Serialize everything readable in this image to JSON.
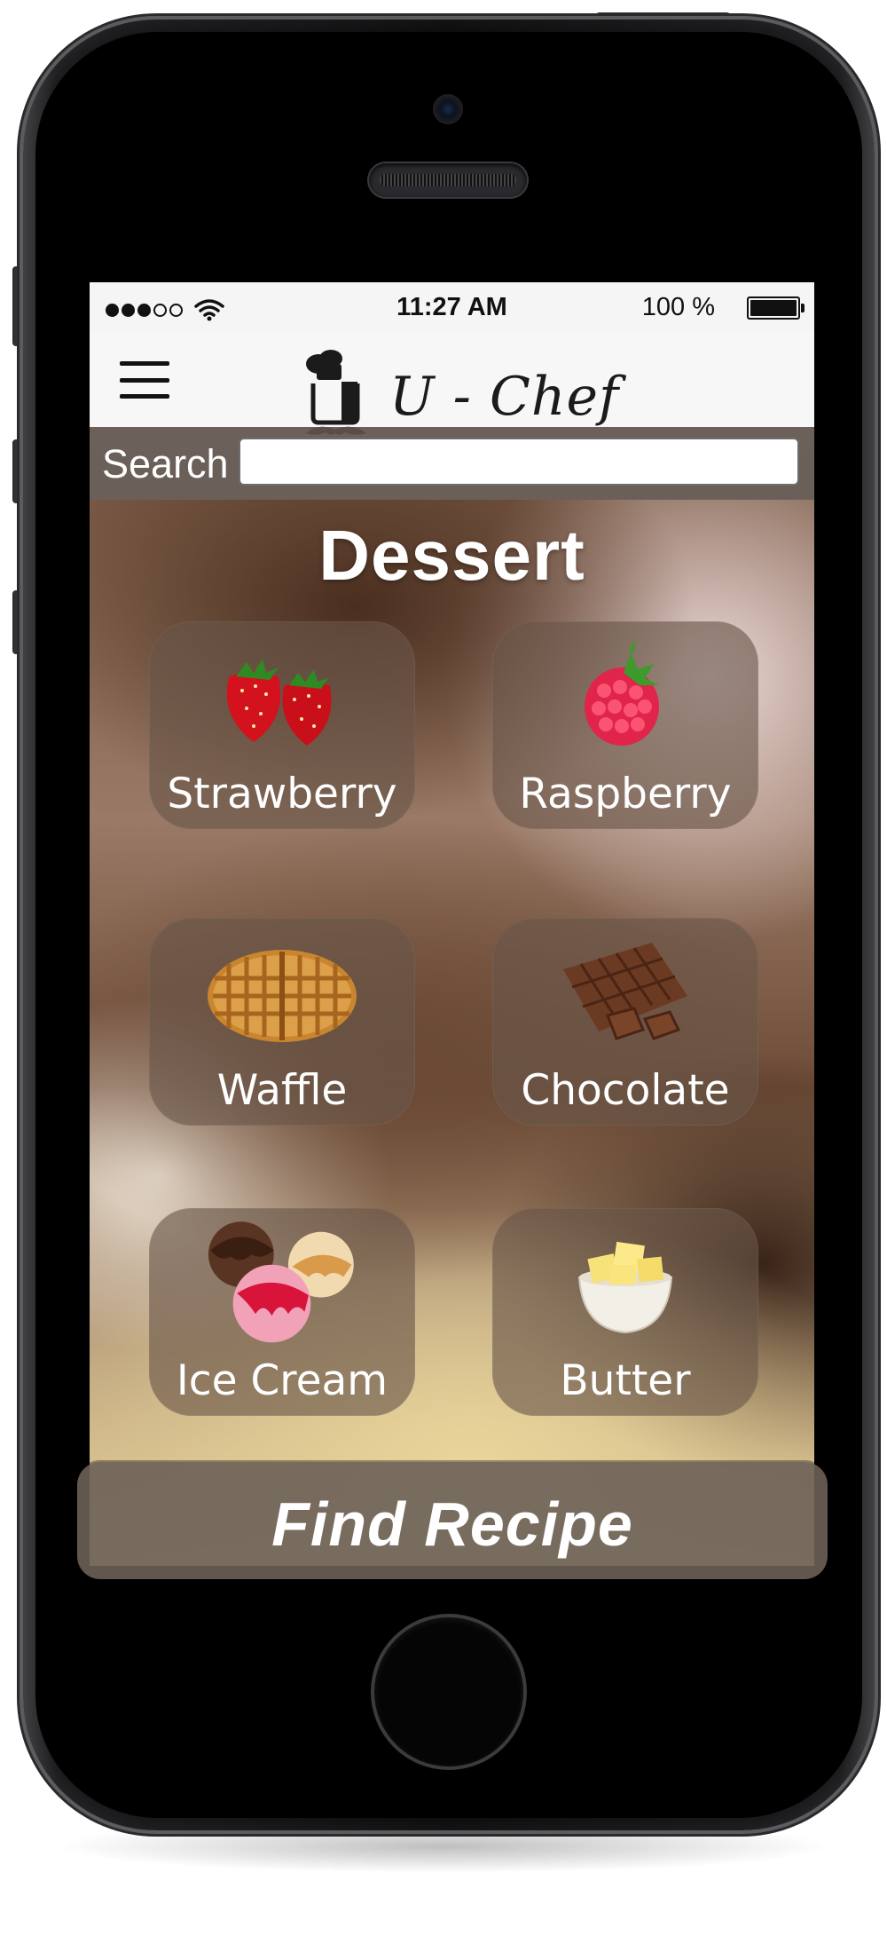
{
  "status_bar": {
    "time": "11:27 AM",
    "battery": "100 %"
  },
  "nav": {
    "app_name": "U - Chef",
    "menu_icon": "hamburger-icon",
    "logo_icon": "chef-mustache-logo"
  },
  "search": {
    "label": "Search",
    "value": "",
    "placeholder": ""
  },
  "page": {
    "title": "Dessert"
  },
  "categories": [
    {
      "label": "Strawberry",
      "icon": "strawberry-icon"
    },
    {
      "label": "Raspberry",
      "icon": "raspberry-icon"
    },
    {
      "label": "Waffle",
      "icon": "waffle-icon"
    },
    {
      "label": "Chocolate",
      "icon": "chocolate-icon"
    },
    {
      "label": "Ice Cream",
      "icon": "ice-cream-icon"
    },
    {
      "label": "Butter",
      "icon": "butter-icon"
    }
  ],
  "actions": {
    "find_recipe": "Find Recipe"
  },
  "colors": {
    "tile_background": "#695648",
    "search_bar": "#5f524c",
    "find_bar": "#6c6058"
  }
}
